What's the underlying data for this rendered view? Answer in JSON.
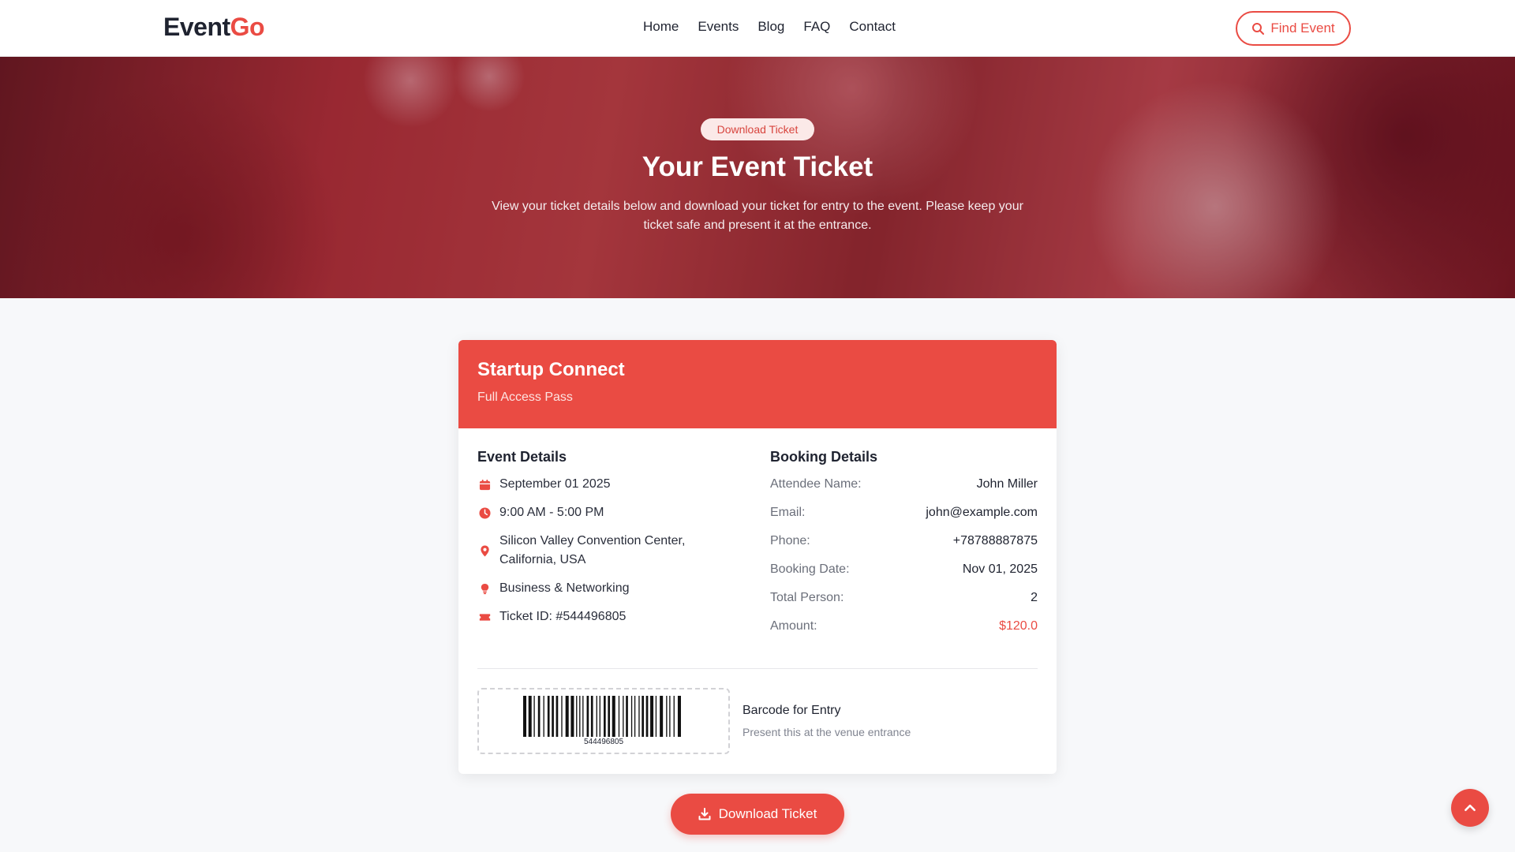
{
  "header": {
    "logo_main": "Event",
    "logo_accent": "Go",
    "nav": [
      "Home",
      "Events",
      "Blog",
      "FAQ",
      "Contact"
    ],
    "find_event_label": "Find Event"
  },
  "hero": {
    "badge": "Download Ticket",
    "title": "Your Event Ticket",
    "description": "View your ticket details below and download your ticket for entry to the event. Please keep your ticket safe and present it at the entrance."
  },
  "ticket": {
    "event_name": "Startup Connect",
    "pass_type": "Full Access Pass",
    "event_details_title": "Event Details",
    "event_details": [
      {
        "icon": "calendar-icon",
        "text": "September 01 2025"
      },
      {
        "icon": "clock-icon",
        "text": "9:00 AM - 5:00 PM"
      },
      {
        "icon": "location-pin-icon",
        "text": "Silicon Valley Convention Center, California, USA"
      },
      {
        "icon": "lightbulb-icon",
        "text": "Business & Networking"
      },
      {
        "icon": "ticket-icon",
        "text": "Ticket ID: #544496805"
      }
    ],
    "booking_details_title": "Booking Details",
    "booking_details": [
      {
        "label": "Attendee Name:",
        "value": "John Miller"
      },
      {
        "label": "Email:",
        "value": "john@example.com"
      },
      {
        "label": "Phone:",
        "value": "+78788887875"
      },
      {
        "label": "Booking Date:",
        "value": "Nov 01, 2025"
      },
      {
        "label": "Total Person:",
        "value": "2"
      },
      {
        "label": "Amount:",
        "value": "$120.0"
      }
    ],
    "barcode_number": "544496805",
    "barcode_label": "Barcode for Entry",
    "barcode_hint": "Present this at the venue entrance"
  },
  "actions": {
    "download_label": "Download Ticket"
  },
  "colors": {
    "accent": "#ea4b43"
  }
}
